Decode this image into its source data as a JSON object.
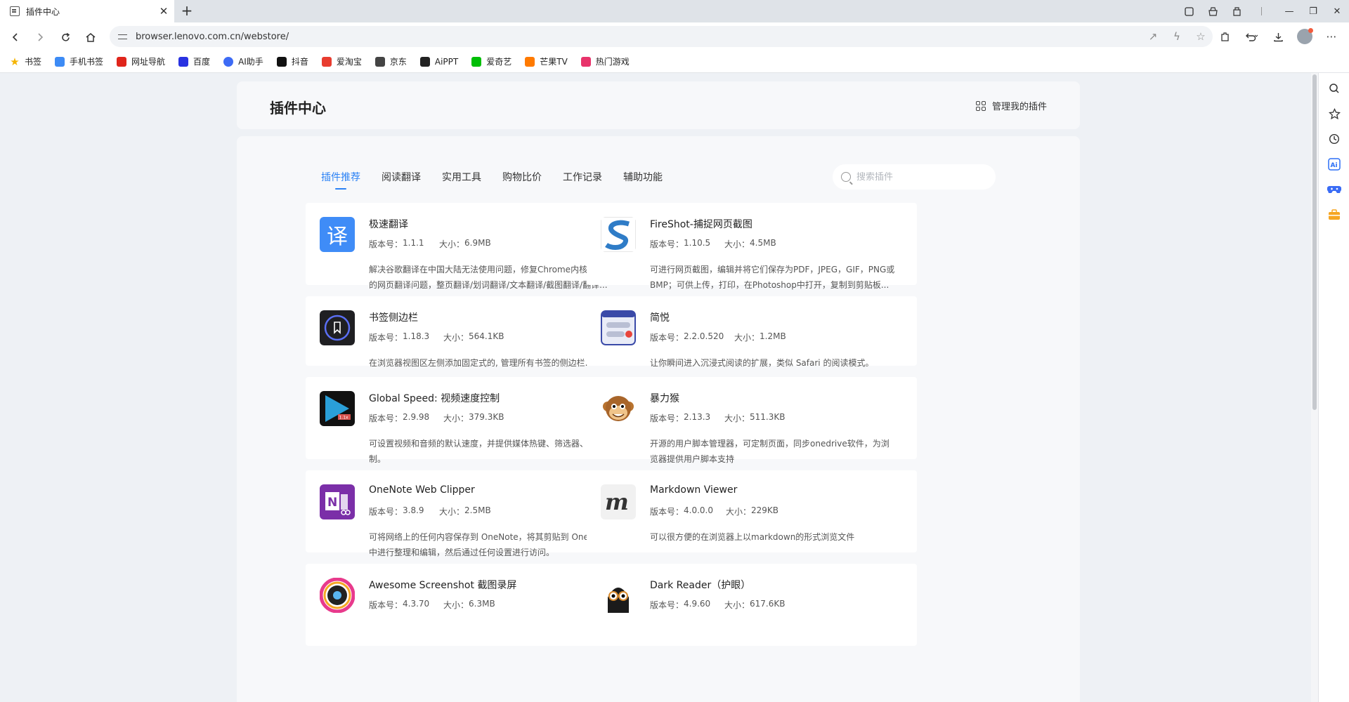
{
  "browser": {
    "tab_title": "插件中心",
    "tab_close": "✕",
    "new_tab": "+",
    "url": "browser.lenovo.com.cn/webstore/",
    "window_controls": [
      "—",
      "❐",
      "✕"
    ]
  },
  "bookmarks": [
    {
      "label": "书签",
      "icon": "star-icon",
      "color": "#f5b400"
    },
    {
      "label": "手机书签",
      "icon": "phone-bookmark-icon",
      "color": "#3d8bf5"
    },
    {
      "label": "网址导航",
      "icon": "navigation-icon",
      "color": "#e0251b"
    },
    {
      "label": "百度",
      "icon": "baidu-icon",
      "color": "#2932e1"
    },
    {
      "label": "AI助手",
      "icon": "ai-assistant-icon",
      "color": "#3d6bf5"
    },
    {
      "label": "抖音",
      "icon": "douyin-icon",
      "color": "#111111"
    },
    {
      "label": "爱淘宝",
      "icon": "taobao-icon",
      "color": "#e83c2f"
    },
    {
      "label": "京东",
      "icon": "jd-icon",
      "color": "#444444"
    },
    {
      "label": "AiPPT",
      "icon": "aippt-icon",
      "color": "#222222"
    },
    {
      "label": "爱奇艺",
      "icon": "iqiyi-icon",
      "color": "#00be06"
    },
    {
      "label": "芒果TV",
      "icon": "mango-tv-icon",
      "color": "#ff7a00"
    },
    {
      "label": "热门游戏",
      "icon": "games-icon",
      "color": "#e8336b"
    }
  ],
  "header": {
    "title": "插件中心",
    "manage_label": "管理我的插件"
  },
  "categories": {
    "tabs": [
      "插件推荐",
      "阅读翻译",
      "实用工具",
      "购物比价",
      "工作记录",
      "辅助功能"
    ],
    "active_index": 0
  },
  "search": {
    "placeholder": "搜索插件",
    "value": ""
  },
  "labels": {
    "version": "版本号：",
    "size": "大小："
  },
  "extensions": [
    {
      "name": "极速翻译",
      "version": "1.1.1",
      "size": "6.9MB",
      "icon": "translate-icon",
      "description": "解决谷歌翻译在中国大陆无法使用问题，修复Chrome内核浏览器的网页翻译问题，整页翻译/划词翻译/文本翻译/截图翻译/翻译..."
    },
    {
      "name": "FireShot-捕捉网页截图",
      "version": "1.10.5",
      "size": "4.5MB",
      "icon": "fireshot-icon",
      "description": "可进行网页截图，编辑并将它们保存为PDF，JPEG，GIF，PNG或BMP；可供上传，打印，在Photoshop中打开，复制到剪贴板..."
    },
    {
      "name": "书签侧边栏",
      "version": "1.18.3",
      "size": "564.1KB",
      "icon": "bookmark-sidebar-icon",
      "description": "在浏览器视图区左侧添加固定式的, 管理所有书签的侧边栏."
    },
    {
      "name": "简悦",
      "version": "2.2.0.520",
      "size": "1.2MB",
      "icon": "simpread-icon",
      "description": "让你瞬间进入沉浸式阅读的扩展，类似 Safari 的阅读模式。"
    },
    {
      "name": "Global Speed: 视频速度控制",
      "version": "2.9.98",
      "size": "379.3KB",
      "icon": "global-speed-icon",
      "description": "可设置视频和音频的默认速度，并提供媒体热键、筛选器、音效控制。"
    },
    {
      "name": "暴力猴",
      "version": "2.13.3",
      "size": "511.3KB",
      "icon": "violentmonkey-icon",
      "description": "开源的用户脚本管理器，可定制页面，同步onedrive软件，为浏览器提供用户脚本支持"
    },
    {
      "name": "OneNote Web Clipper",
      "version": "3.8.9",
      "size": "2.5MB",
      "icon": "onenote-icon",
      "description": "可将网络上的任何内容保存到 OneNote，将其剪贴到 OneNote 中进行整理和编辑，然后通过任何设置进行访问。"
    },
    {
      "name": "Markdown Viewer",
      "version": "4.0.0.0",
      "size": "229KB",
      "icon": "markdown-viewer-icon",
      "description": "可以很方便的在浏览器上以markdown的形式浏览文件"
    },
    {
      "name": "Awesome Screenshot 截图录屏",
      "version": "4.3.70",
      "size": "6.3MB",
      "icon": "awesome-screenshot-icon",
      "description": ""
    },
    {
      "name": "Dark Reader（护眼）",
      "version": "4.9.60",
      "size": "617.6KB",
      "icon": "dark-reader-icon",
      "description": ""
    }
  ],
  "sidebar": [
    "search-icon",
    "favorites-icon",
    "history-icon",
    "ai-icon",
    "gamepad-icon",
    "toolbox-icon"
  ],
  "colors": {
    "accent": "#2b82f5",
    "page_bg": "#eef1f5",
    "card_bg": "#ffffff"
  }
}
